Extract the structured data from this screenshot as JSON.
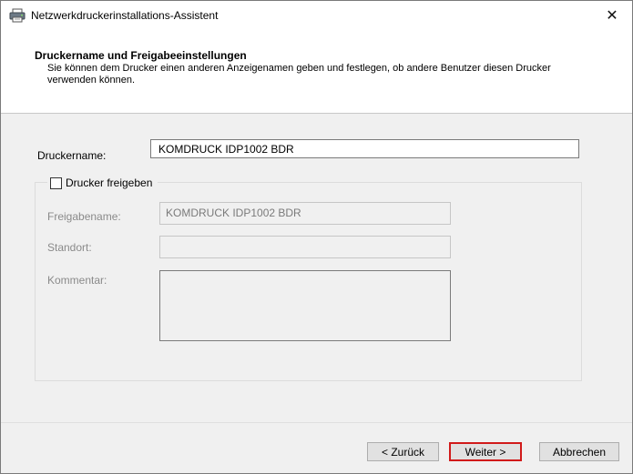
{
  "window": {
    "title": "Netzwerkdruckerinstallations-Assistent",
    "close_glyph": "✕"
  },
  "header": {
    "title": "Druckername und Freigabeeinstellungen",
    "description": "Sie können dem Drucker einen anderen Anzeigenamen geben und festlegen, ob andere Benutzer diesen Drucker verwenden können."
  },
  "form": {
    "printer_name_label": "Druckername:",
    "printer_name_value": "KOMDRUCK IDP1002 BDR",
    "share_label": "Drucker freigeben",
    "share_checked": false,
    "share_name_label": "Freigabename:",
    "share_name_value": "KOMDRUCK IDP1002 BDR",
    "location_label": "Standort:",
    "location_value": "",
    "comment_label": "Kommentar:",
    "comment_value": ""
  },
  "buttons": {
    "back": "< Zurück",
    "next": "Weiter >",
    "cancel": "Abbrechen"
  },
  "colors": {
    "highlight_border": "#d11a1a"
  },
  "icons": {
    "title": "printer-icon",
    "close": "close-icon"
  }
}
